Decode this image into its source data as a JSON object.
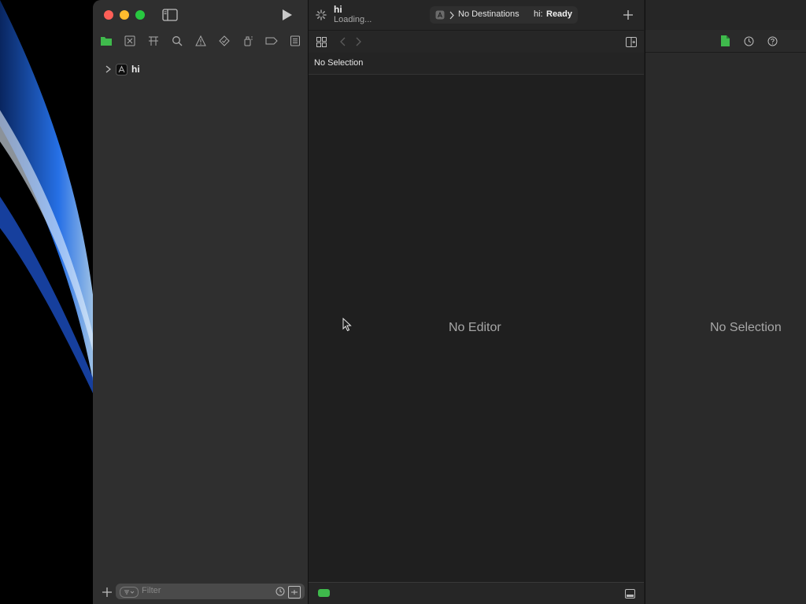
{
  "window": {
    "project_name": "hi",
    "status_text": "Loading...",
    "scheme": {
      "destination": "No Destinations",
      "project": "hi:",
      "state": "Ready"
    }
  },
  "navigator": {
    "tree": [
      {
        "label": "hi",
        "icon": "xcode-project-icon",
        "expanded": false
      }
    ],
    "filter_placeholder": "Filter"
  },
  "editor": {
    "selection_label": "No Selection",
    "empty_label": "No Editor"
  },
  "inspector": {
    "empty_label": "No Selection"
  },
  "colors": {
    "accent_green": "#3fba4c",
    "window_bg": "#1e1e1e",
    "sidebar_bg": "#2f2f2f"
  }
}
